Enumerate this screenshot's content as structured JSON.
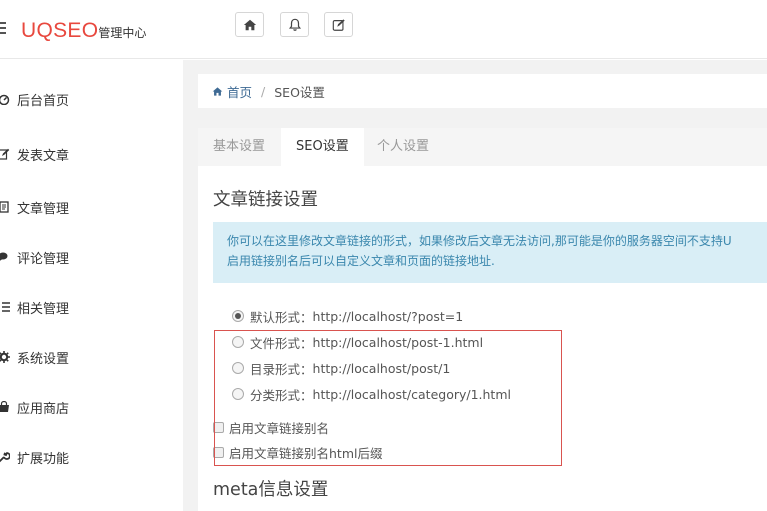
{
  "header": {
    "logo_main": "UQSEO",
    "logo_sub": "管理中心",
    "buttons": [
      {
        "name": "home-button",
        "icon": "home-icon"
      },
      {
        "name": "notifications-button",
        "icon": "bell-icon"
      },
      {
        "name": "edit-button",
        "icon": "edit-icon"
      }
    ]
  },
  "sidebar": {
    "items": [
      {
        "label": "后台首页",
        "icon": "dashboard-icon"
      },
      {
        "label": "发表文章",
        "icon": "pencil-icon"
      },
      {
        "label": "文章管理",
        "icon": "document-icon"
      },
      {
        "label": "评论管理",
        "icon": "comments-icon"
      },
      {
        "label": "相关管理",
        "icon": "list-icon"
      },
      {
        "label": "系统设置",
        "icon": "gear-icon"
      },
      {
        "label": "应用商店",
        "icon": "shop-icon"
      },
      {
        "label": "扩展功能",
        "icon": "wrench-icon"
      }
    ]
  },
  "breadcrumb": {
    "home": "首页",
    "separator": "/",
    "current": "SEO设置"
  },
  "tabs": [
    {
      "label": "基本设置",
      "active": false
    },
    {
      "label": "SEO设置",
      "active": true
    },
    {
      "label": "个人设置",
      "active": false
    }
  ],
  "content": {
    "section_title": "文章链接设置",
    "alert_line1": "你可以在这里修改文章链接的形式，如果修改后文章无法访问,那可能是你的服务器空间不支持U",
    "alert_line2": "启用链接别名后可以自定义文章和页面的链接地址.",
    "options": [
      {
        "name": "默认形式：",
        "url": "http://localhost/?post=1",
        "checked": true
      },
      {
        "name": "文件形式：",
        "url": "http://localhost/post-1.html",
        "checked": false
      },
      {
        "name": "目录形式：",
        "url": "http://localhost/post/1",
        "checked": false
      },
      {
        "name": "分类形式：",
        "url": "http://localhost/category/1.html",
        "checked": false
      }
    ],
    "checkboxes": [
      {
        "label": "启用文章链接别名"
      },
      {
        "label": "启用文章链接别名html后缀"
      }
    ],
    "meta_title": "meta信息设置"
  },
  "colors": {
    "logo_accent": "#e8483e",
    "alert_bg": "#d9eef6",
    "alert_text": "#3a87ad",
    "highlight_border": "#d9534f"
  }
}
